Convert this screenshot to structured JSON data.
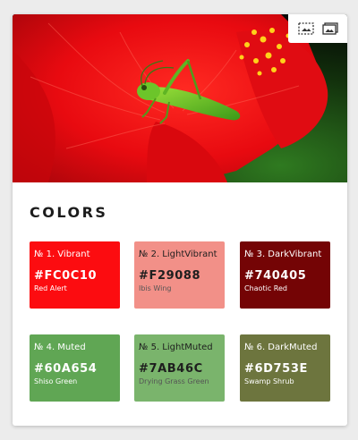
{
  "image_tools": {
    "left_icon": "dashed-frame-image-icon",
    "right_icon": "image-icon"
  },
  "section": {
    "title": "COLORS"
  },
  "swatches": [
    {
      "label": "№ 1. Vibrant",
      "hex": "#FC0C10",
      "name": "Red Alert",
      "color": "#FC0C10",
      "text_tone": "light"
    },
    {
      "label": "№ 2. LightVibrant",
      "hex": "#F29088",
      "name": "Ibis Wing",
      "color": "#F29088",
      "text_tone": "dark"
    },
    {
      "label": "№ 3. DarkVibrant",
      "hex": "#740405",
      "name": "Chaotic Red",
      "color": "#740405",
      "text_tone": "light"
    },
    {
      "label": "№ 4. Muted",
      "hex": "#60A654",
      "name": "Shiso Green",
      "color": "#60A654",
      "text_tone": "light"
    },
    {
      "label": "№ 5. LightMuted",
      "hex": "#7AB46C",
      "name": "Drying Grass Green",
      "color": "#7AB46C",
      "text_tone": "dark"
    },
    {
      "label": "№ 6. DarkMuted",
      "hex": "#6D753E",
      "name": "Swamp Shrub",
      "color": "#6D753E",
      "text_tone": "light"
    }
  ]
}
